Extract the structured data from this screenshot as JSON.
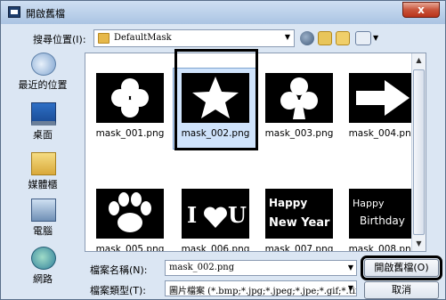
{
  "window": {
    "title": "開啟舊檔",
    "close_label": "x"
  },
  "lookin": {
    "label": "搜尋位置(I):",
    "value": "DefaultMask"
  },
  "places": [
    {
      "label": "最近的位置",
      "icon": "recent-places-icon"
    },
    {
      "label": "桌面",
      "icon": "desktop-icon"
    },
    {
      "label": "媒體櫃",
      "icon": "library-icon"
    },
    {
      "label": "電腦",
      "icon": "computer-icon"
    },
    {
      "label": "網路",
      "icon": "network-icon"
    }
  ],
  "files": [
    {
      "name": "mask_001.png",
      "shape": "flower"
    },
    {
      "name": "mask_002.png",
      "shape": "star",
      "selected": true
    },
    {
      "name": "mask_003.png",
      "shape": "club"
    },
    {
      "name": "mask_004.png",
      "shape": "arrow"
    },
    {
      "name": "mask_005.png",
      "shape": "paw"
    },
    {
      "name": "mask_006.png",
      "shape": "iloveu",
      "text": "I U"
    },
    {
      "name": "mask_007.png",
      "shape": "newyear",
      "text1": "Happy",
      "text2": "New Year"
    },
    {
      "name": "mask_008.png",
      "shape": "birthday",
      "text1": "Happy",
      "text2": "Birthday"
    }
  ],
  "filename": {
    "label": "檔案名稱(N):",
    "value": "mask_002.png"
  },
  "filetype": {
    "label": "檔案類型(T):",
    "value": "圖片檔案 (*.bmp;*.jpg;*.jpeg;*.jpe;*.gif;*.tif;"
  },
  "buttons": {
    "open": "開啟舊檔(O)",
    "cancel": "取消"
  }
}
